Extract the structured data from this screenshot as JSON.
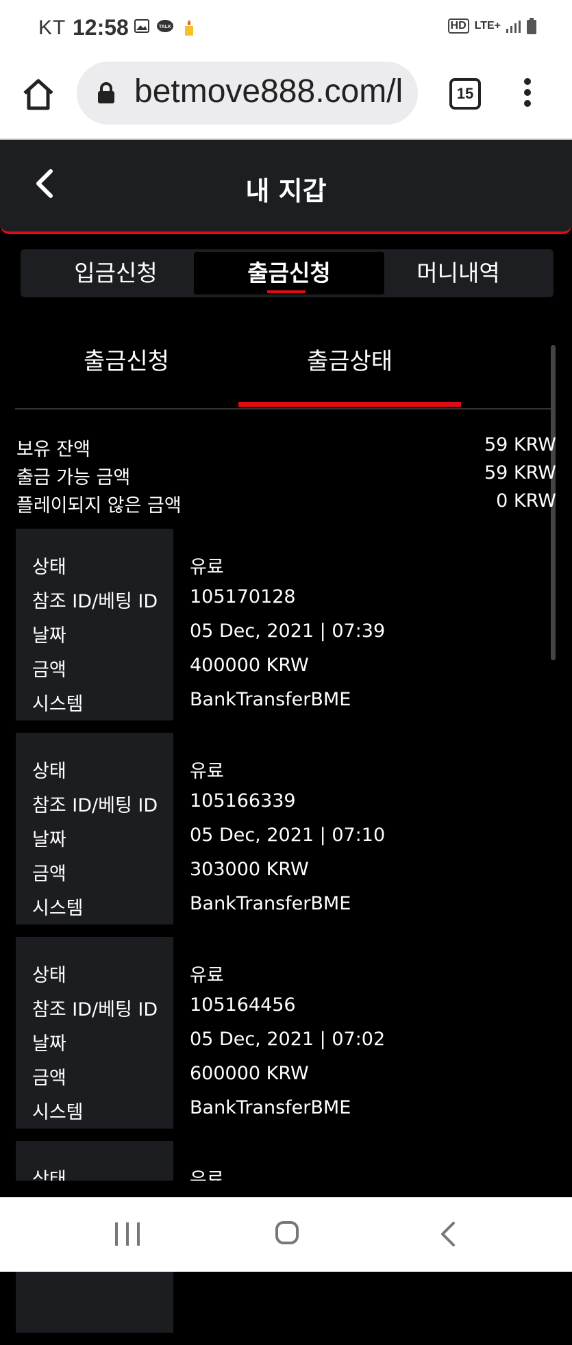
{
  "status_bar": {
    "carrier": "KT",
    "time": "12:58",
    "right_icons": [
      "hd-icon",
      "lte-plus-icon",
      "signal-icon",
      "battery-icon"
    ],
    "hd_label": "HD",
    "lte_label": "LTE+"
  },
  "browser": {
    "url": "betmove888.com/l",
    "tab_count": "15"
  },
  "header": {
    "title": "내 지갑"
  },
  "segment_tabs": [
    {
      "label": "입금신청",
      "active": false
    },
    {
      "label": "출금신청",
      "active": true
    },
    {
      "label": "머니내역",
      "active": false
    }
  ],
  "sub_tabs": [
    {
      "label": "출금신청",
      "active": false
    },
    {
      "label": "출금상태",
      "active": true
    }
  ],
  "balances": [
    {
      "label": "보유 잔액",
      "value": "59 KRW"
    },
    {
      "label": "출금 가능 금액",
      "value": "59 KRW"
    },
    {
      "label": "플레이되지 않은 금액",
      "value": "0 KRW"
    }
  ],
  "field_labels": {
    "status": "상태",
    "ref_id": "참조 ID/베팅 ID",
    "date": "날짜",
    "amount": "금액",
    "system": "시스템"
  },
  "records": [
    {
      "status": "유료",
      "ref_id": "105170128",
      "date": "05 Dec, 2021 | 07:39",
      "amount": "400000 KRW",
      "system": "BankTransferBME"
    },
    {
      "status": "유료",
      "ref_id": "105166339",
      "date": "05 Dec, 2021 | 07:10",
      "amount": "303000 KRW",
      "system": "BankTransferBME"
    },
    {
      "status": "유료",
      "ref_id": "105164456",
      "date": "05 Dec, 2021 | 07:02",
      "amount": "600000 KRW",
      "system": "BankTransferBME"
    },
    {
      "status": "유료",
      "ref_id": "",
      "date": "",
      "amount": "",
      "system": ""
    }
  ],
  "colors": {
    "accent": "#e10b14",
    "panel": "#1d1e22",
    "background": "#000000"
  }
}
